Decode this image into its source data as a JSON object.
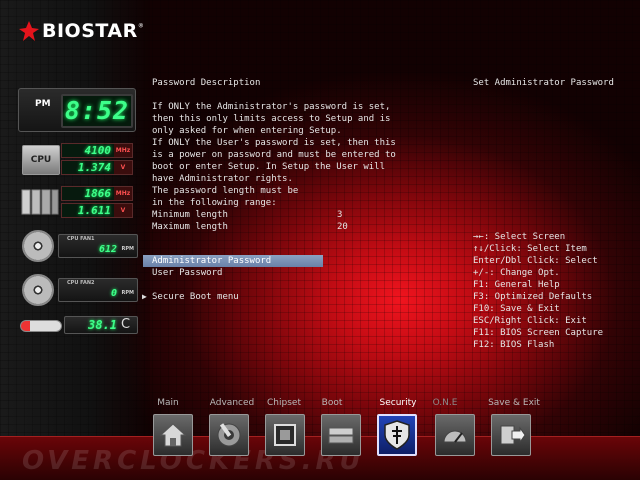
{
  "brand": {
    "name": "BIOSTAR",
    "trademark": "®"
  },
  "clock": {
    "ampm": "PM",
    "time": "8:52"
  },
  "monitor": {
    "cpu": {
      "label": "CPU",
      "freq": "4100",
      "freq_unit": "MHz",
      "volt": "1.374",
      "volt_unit": "V"
    },
    "memory": {
      "freq": "1866",
      "freq_unit": "MHz",
      "volt": "1.611",
      "volt_unit": "V"
    },
    "fan1": {
      "label": "CPU FAN1",
      "value": "612",
      "unit": "RPM"
    },
    "fan2": {
      "label": "CPU FAN2",
      "value": "0",
      "unit": "RPM"
    },
    "temp": {
      "value": "38.1",
      "unit": "C"
    }
  },
  "content": {
    "title": "Password Description",
    "description": "If ONLY the Administrator's password is set,\nthen this only limits access to Setup and is\nonly asked for when entering Setup.\nIf ONLY the User's password is set, then this\nis a power on password and must be entered to\nboot or enter Setup. In Setup the User will\nhave Administrator rights.\nThe password length must be\nin the following range:",
    "min_label": "Minimum length",
    "min_value": "3",
    "max_label": "Maximum length",
    "max_value": "20",
    "items": [
      {
        "label": "Administrator Password",
        "selected": true
      },
      {
        "label": "User Password",
        "selected": false
      }
    ],
    "submenu_marker": "▶",
    "submenu": "Secure Boot menu"
  },
  "help": {
    "item_help": "Set Administrator Password",
    "keys": "→←: Select Screen\n↑↓/Click: Select Item\nEnter/Dbl Click: Select\n+/-: Change Opt.\nF1: General Help\nF3: Optimized Defaults\nF10: Save & Exit\nESC/Right Click: Exit\nF11: BIOS Screen Capture\nF12: BIOS Flash"
  },
  "nav": {
    "tabs": [
      {
        "label": "Main",
        "icon": "home-icon"
      },
      {
        "label": "Advanced",
        "icon": "wrench-icon"
      },
      {
        "label": "Chipset",
        "icon": "chip-icon"
      },
      {
        "label": "Boot",
        "icon": "drive-icon"
      },
      {
        "label": "Security",
        "icon": "shield-icon",
        "active": true
      },
      {
        "label": "O.N.E",
        "icon": "speedometer-icon"
      },
      {
        "label": "Save & Exit",
        "icon": "exit-icon"
      }
    ],
    "active_color": "#1c3aa8"
  },
  "footer_watermark": "OVERCLOCKERS.RU",
  "colors": {
    "accent": "#e5141c",
    "lcd": "#3dff8a",
    "selection": "#7c93b8"
  }
}
